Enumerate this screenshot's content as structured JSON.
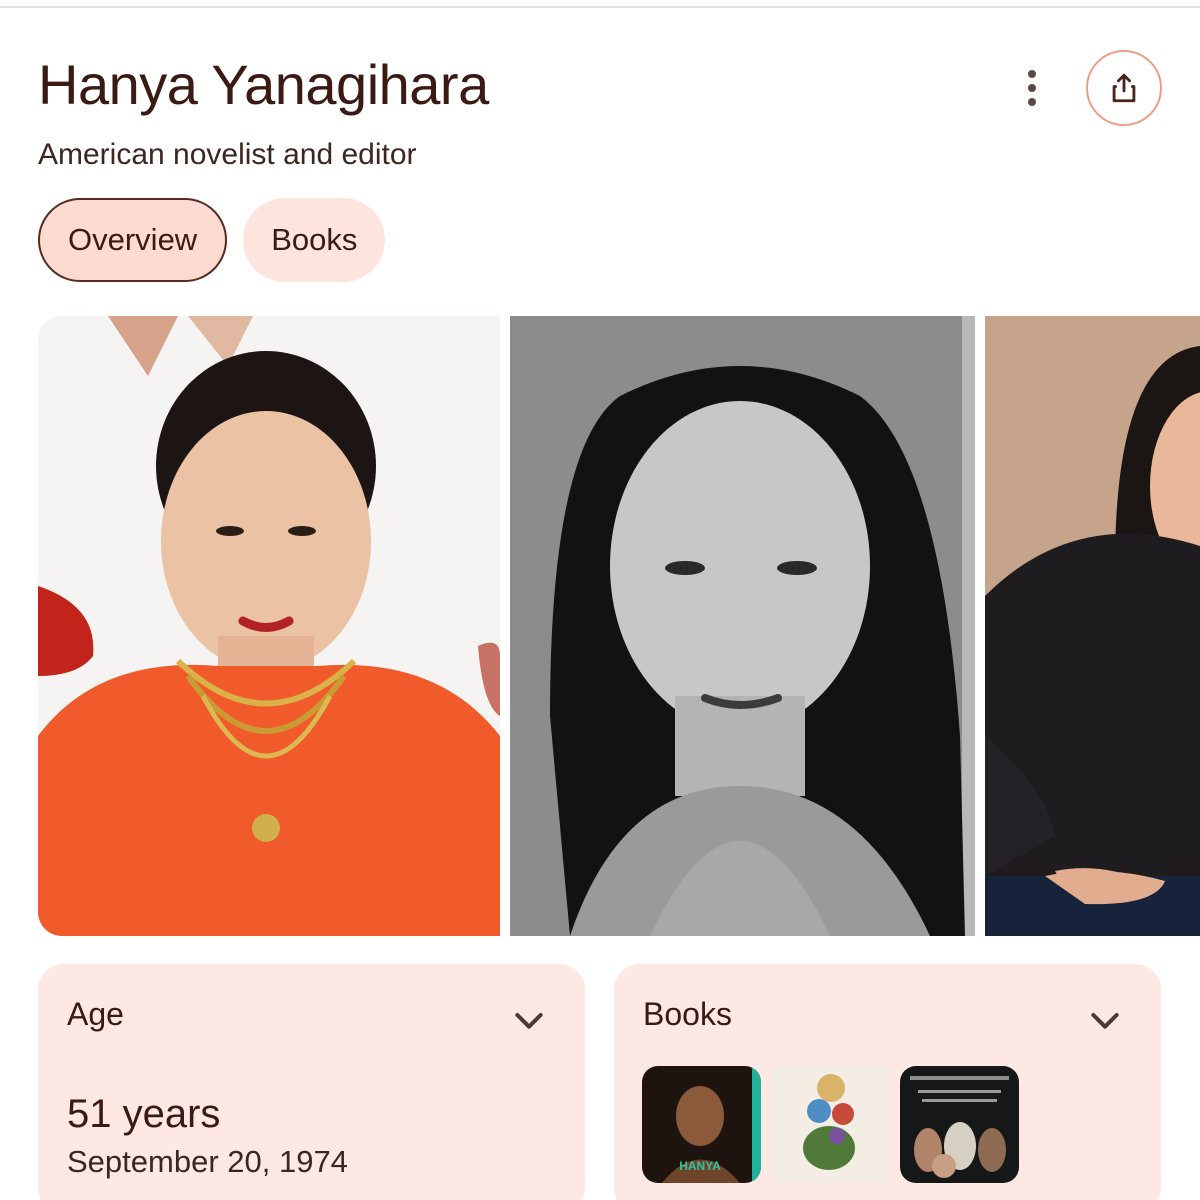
{
  "header": {
    "title": "Hanya Yanagihara",
    "subtitle": "American novelist and editor"
  },
  "actions": {
    "more_icon": "more-vert-icon",
    "share_icon": "share-icon"
  },
  "tabs": [
    {
      "label": "Overview",
      "active": true
    },
    {
      "label": "Books",
      "active": false
    }
  ],
  "gallery": {
    "images": [
      {
        "description": "photo-1"
      },
      {
        "description": "photo-2"
      },
      {
        "description": "photo-3"
      }
    ]
  },
  "cards": {
    "age": {
      "title": "Age",
      "value": "51 years",
      "date": "September 20, 1974"
    },
    "books": {
      "title": "Books",
      "thumb_cover_text": "HANYA"
    }
  },
  "colors": {
    "accent": "#ee9c86",
    "chip_bg": "#fde4dd",
    "card_bg": "#fde8e3",
    "text": "#3a1a12"
  }
}
